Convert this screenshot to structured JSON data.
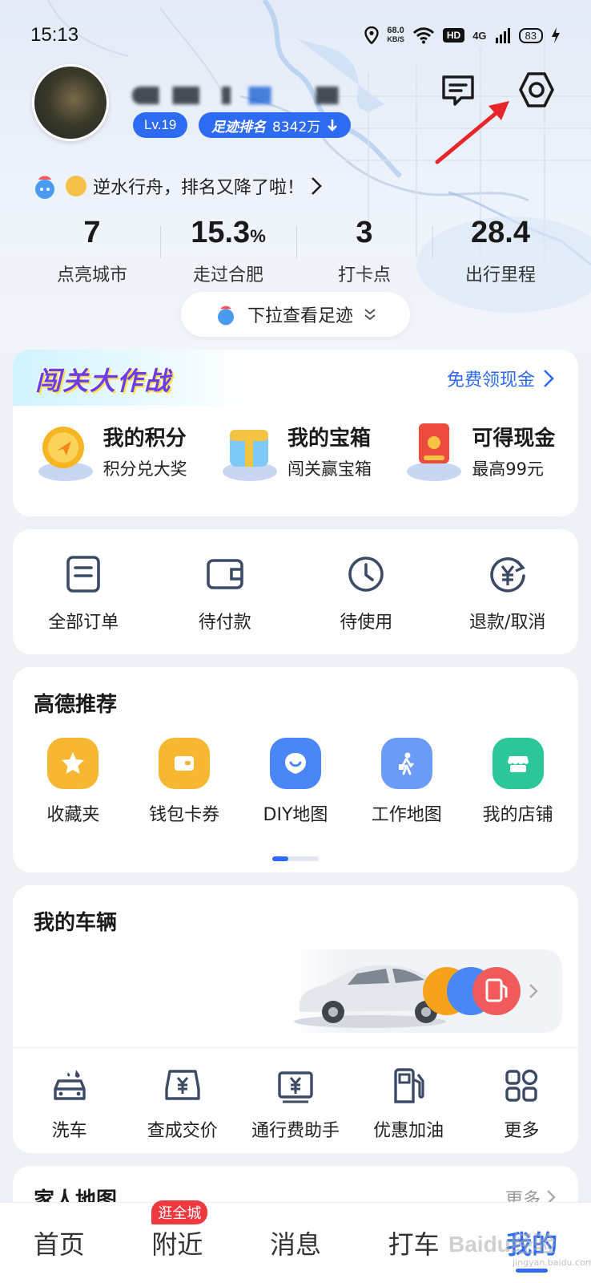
{
  "status_bar": {
    "time": "15:13",
    "speed_value": "68.0",
    "speed_unit": "KB/S",
    "hd": "HD",
    "network": "4G",
    "battery": "83"
  },
  "profile": {
    "level": "Lv.19",
    "rank_label": "足迹排名",
    "rank_value": "8342万",
    "rank_trend": "down"
  },
  "slogan": {
    "text": "逆水行舟，排名又降了啦！"
  },
  "stats": [
    {
      "value": "7",
      "unit": "",
      "label": "点亮城市"
    },
    {
      "value": "15.3",
      "unit": "%",
      "label": "走过合肥"
    },
    {
      "value": "3",
      "unit": "",
      "label": "打卡点"
    },
    {
      "value": "28.4",
      "unit": "",
      "label": "出行里程"
    }
  ],
  "pull_hint": "下拉查看足迹",
  "challenge": {
    "title": "闯关大作战",
    "link": "免费领现金",
    "items": [
      {
        "title": "我的积分",
        "subtitle": "积分兑大奖"
      },
      {
        "title": "我的宝箱",
        "subtitle": "闯关赢宝箱"
      },
      {
        "title": "可得现金",
        "subtitle": "最高99元"
      }
    ]
  },
  "orders": [
    {
      "label": "全部订单",
      "icon": "order-list-icon"
    },
    {
      "label": "待付款",
      "icon": "wallet-icon"
    },
    {
      "label": "待使用",
      "icon": "clock-icon"
    },
    {
      "label": "退款/取消",
      "icon": "refund-icon"
    }
  ],
  "recommend": {
    "title": "高德推荐",
    "items": [
      {
        "label": "收藏夹",
        "icon": "star-icon",
        "color": "#f7b733"
      },
      {
        "label": "钱包卡券",
        "icon": "wallet-card-icon",
        "color": "#f7b733"
      },
      {
        "label": "DIY地图",
        "icon": "diy-map-icon",
        "color": "#4a86f5"
      },
      {
        "label": "工作地图",
        "icon": "walker-icon",
        "color": "#6b9af7"
      },
      {
        "label": "我的店铺",
        "icon": "shop-icon",
        "color": "#2bc79a"
      }
    ]
  },
  "vehicle": {
    "title": "我的车辆",
    "services": [
      {
        "label": "洗车",
        "icon": "car-wash-icon"
      },
      {
        "label": "查成交价",
        "icon": "car-price-icon"
      },
      {
        "label": "通行费助手",
        "icon": "toll-icon"
      },
      {
        "label": "优惠加油",
        "icon": "fuel-icon"
      },
      {
        "label": "更多",
        "icon": "grid-icon"
      }
    ]
  },
  "family_map": {
    "title": "家人地图",
    "more": "更多"
  },
  "bottom_nav": [
    {
      "label": "首页",
      "active": false
    },
    {
      "label": "附近",
      "active": false,
      "badge": "逛全城"
    },
    {
      "label": "消息",
      "active": false
    },
    {
      "label": "打车",
      "active": false
    },
    {
      "label": "我的",
      "active": true
    }
  ],
  "watermark": {
    "text": "Baidu经验",
    "sub": "jingyan.baidu.com"
  },
  "colors": {
    "accent": "#2d6bf2",
    "annotation_arrow": "#e8262a"
  }
}
